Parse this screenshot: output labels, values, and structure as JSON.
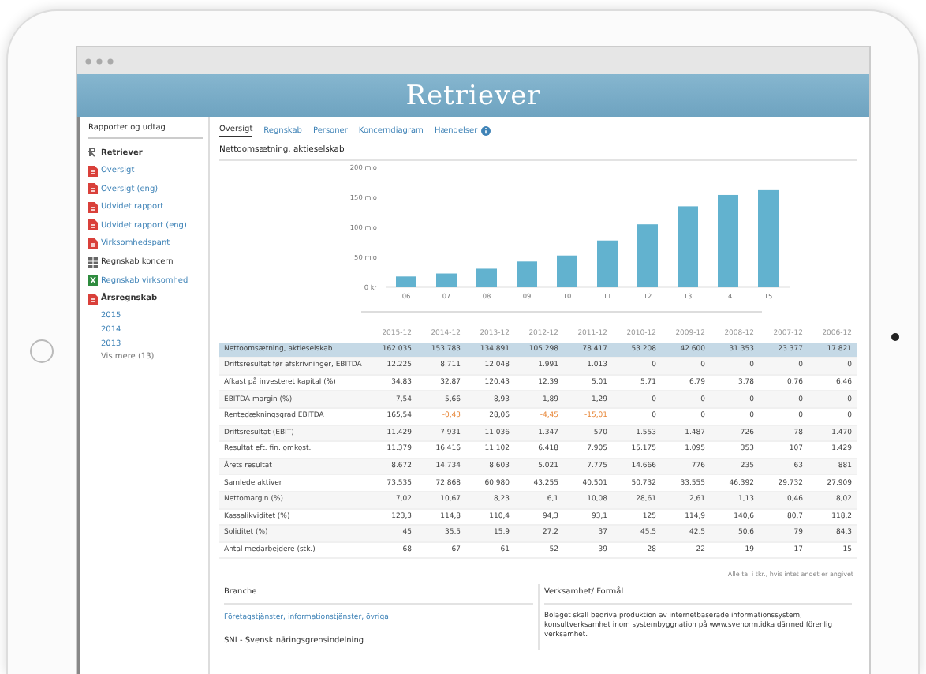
{
  "header": {
    "logo": "Retriever"
  },
  "sidebar": {
    "title": "Rapporter og udtag",
    "items": [
      {
        "kind": "brand",
        "label": "Retriever"
      },
      {
        "kind": "pdf",
        "label": "Oversigt"
      },
      {
        "kind": "pdf",
        "label": "Oversigt (eng)"
      },
      {
        "kind": "pdf",
        "label": "Udvidet rapport"
      },
      {
        "kind": "pdf",
        "label": "Udvidet rapport (eng)"
      },
      {
        "kind": "pdf",
        "label": "Virksomhedspant"
      },
      {
        "kind": "table",
        "label": "Regnskab koncern"
      },
      {
        "kind": "sheet",
        "label": "Regnskab virksomhed"
      },
      {
        "kind": "pdf-group",
        "label": "Årsregnskab",
        "children": [
          {
            "label": "2015"
          },
          {
            "label": "2014"
          },
          {
            "label": "2013"
          }
        ]
      }
    ],
    "more": "Vis mere (13)"
  },
  "tabs": [
    {
      "label": "Oversigt",
      "selected": true
    },
    {
      "label": "Regnskab",
      "selected": false
    },
    {
      "label": "Personer",
      "selected": false
    },
    {
      "label": "Koncerndiagram",
      "selected": false
    },
    {
      "label": "Hændelser",
      "selected": false,
      "badge": true
    }
  ],
  "chart_title": "Nettoomsætning, aktieselskab",
  "chart_data": {
    "type": "bar",
    "categories": [
      "06",
      "07",
      "08",
      "09",
      "10",
      "11",
      "12",
      "13",
      "14",
      "15"
    ],
    "values": [
      18,
      23,
      31,
      43,
      53,
      78,
      105,
      135,
      154,
      162
    ],
    "ylim": [
      0,
      200
    ],
    "yticks": [
      {
        "value": 0,
        "label": "0 kr"
      },
      {
        "value": 50,
        "label": "50 mio"
      },
      {
        "value": 100,
        "label": "100 mio"
      },
      {
        "value": 150,
        "label": "150 mio"
      },
      {
        "value": 200,
        "label": "200 mio"
      }
    ]
  },
  "table": {
    "columns": [
      "2015-12",
      "2014-12",
      "2013-12",
      "2012-12",
      "2011-12",
      "2010-12",
      "2009-12",
      "2008-12",
      "2007-12",
      "2006-12"
    ],
    "rows": [
      {
        "label": "Nettoomsætning, aktieselskab",
        "highlighted": true,
        "values": [
          "162.035",
          "153.783",
          "134.891",
          "105.298",
          "78.417",
          "53.208",
          "42.600",
          "31.353",
          "23.377",
          "17.821"
        ]
      },
      {
        "label": "Driftsresultat før afskrivninger, EBITDA",
        "highlighted": false,
        "values": [
          "12.225",
          "8.711",
          "12.048",
          "1.991",
          "1.013",
          "0",
          "0",
          "0",
          "0",
          "0"
        ]
      },
      {
        "label": "Afkast på investeret kapital (%)",
        "highlighted": false,
        "values": [
          "34,83",
          "32,87",
          "120,43",
          "12,39",
          "5,01",
          "5,71",
          "6,79",
          "3,78",
          "0,76",
          "6,46"
        ]
      },
      {
        "label": "EBITDA-margin (%)",
        "highlighted": false,
        "values": [
          "7,54",
          "5,66",
          "8,93",
          "1,89",
          "1,29",
          "0",
          "0",
          "0",
          "0",
          "0"
        ]
      },
      {
        "label": "Rentedækningsgrad EBITDA",
        "highlighted": false,
        "warnings": [
          false,
          true,
          false,
          true,
          true,
          false,
          false,
          false,
          false,
          false
        ],
        "values": [
          "165,54",
          "-0,43",
          "28,06",
          "-4,45",
          "-15,01",
          "0",
          "0",
          "0",
          "0",
          "0"
        ]
      },
      {
        "label": "Driftsresultat (EBIT)",
        "highlighted": false,
        "values": [
          "11.429",
          "7.931",
          "11.036",
          "1.347",
          "570",
          "1.553",
          "1.487",
          "726",
          "78",
          "1.470"
        ]
      },
      {
        "label": "Resultat eft. fin. omkost.",
        "highlighted": false,
        "values": [
          "11.379",
          "16.416",
          "11.102",
          "6.418",
          "7.905",
          "15.175",
          "1.095",
          "353",
          "107",
          "1.429"
        ]
      },
      {
        "label": "Årets resultat",
        "highlighted": false,
        "values": [
          "8.672",
          "14.734",
          "8.603",
          "5.021",
          "7.775",
          "14.666",
          "776",
          "235",
          "63",
          "881"
        ]
      },
      {
        "label": "Samlede aktiver",
        "highlighted": false,
        "values": [
          "73.535",
          "72.868",
          "60.980",
          "43.255",
          "40.501",
          "50.732",
          "33.555",
          "46.392",
          "29.732",
          "27.909"
        ]
      },
      {
        "label": "Nettomargin (%)",
        "highlighted": false,
        "values": [
          "7,02",
          "10,67",
          "8,23",
          "6,1",
          "10,08",
          "28,61",
          "2,61",
          "1,13",
          "0,46",
          "8,02"
        ]
      },
      {
        "label": "Kassalikviditet (%)",
        "highlighted": false,
        "values": [
          "123,3",
          "114,8",
          "110,4",
          "94,3",
          "93,1",
          "125",
          "114,9",
          "140,6",
          "80,7",
          "118,2"
        ]
      },
      {
        "label": "Soliditet (%)",
        "highlighted": false,
        "values": [
          "45",
          "35,5",
          "15,9",
          "27,2",
          "37",
          "45,5",
          "42,5",
          "50,6",
          "79",
          "84,3"
        ]
      },
      {
        "label": "Antal medarbejdere (stk.)",
        "highlighted": false,
        "values": [
          "68",
          "67",
          "61",
          "52",
          "39",
          "28",
          "22",
          "19",
          "17",
          "15"
        ]
      }
    ],
    "footnote": "Alle tal i tkr., hvis intet andet er angivet"
  },
  "branch": {
    "title": "Branche",
    "link": "Företagstjänster, informationstjänster, övriga",
    "subtitle": "SNI - Svensk näringsgrensindelning"
  },
  "purpose": {
    "title": "Verksamhet/ Formål",
    "text": "Bolaget skall bedriva produktion av internetbaserade informationssystem, konsultverksamhet inom systembyggnation på www.svenorm.idka därmed förenlig verksamhet."
  }
}
